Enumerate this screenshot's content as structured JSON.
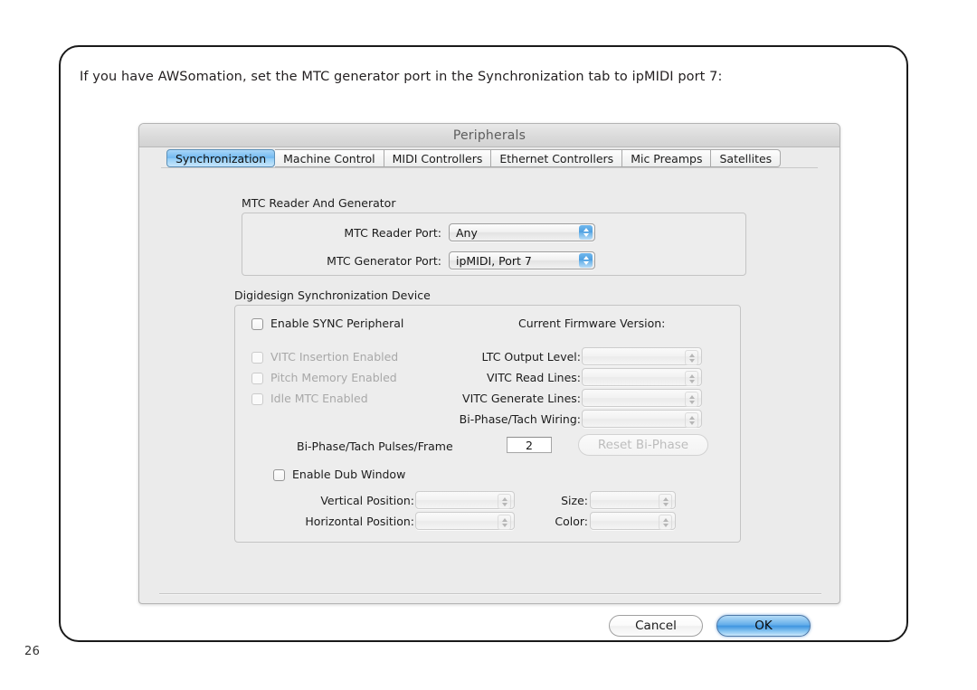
{
  "page": {
    "number": "26",
    "intro_text": "If you have AWSomation, set the MTC generator port in the Synchronization tab to ipMIDI port 7:"
  },
  "dialog": {
    "title": "Peripherals",
    "tabs": [
      {
        "label": "Synchronization",
        "active": true
      },
      {
        "label": "Machine Control",
        "active": false
      },
      {
        "label": "MIDI Controllers",
        "active": false
      },
      {
        "label": "Ethernet Controllers",
        "active": false
      },
      {
        "label": "Mic Preamps",
        "active": false
      },
      {
        "label": "Satellites",
        "active": false
      }
    ],
    "mtc_group": {
      "label": "MTC Reader And Generator",
      "reader_label": "MTC Reader Port:",
      "reader_value": "Any",
      "generator_label": "MTC Generator Port:",
      "generator_value": "ipMIDI, Port 7"
    },
    "sync_group": {
      "label": "Digidesign Synchronization Device",
      "enable_sync_label": "Enable SYNC Peripheral",
      "firmware_label": "Current Firmware Version:",
      "firmware_value": "",
      "vitc_insertion_label": "VITC Insertion Enabled",
      "pitch_memory_label": "Pitch Memory Enabled",
      "idle_mtc_label": "Idle MTC Enabled",
      "ltc_output_label": "LTC Output Level:",
      "ltc_output_value": "",
      "vitc_read_label": "VITC Read Lines:",
      "vitc_read_value": "",
      "vitc_generate_label": "VITC Generate Lines:",
      "vitc_generate_value": "",
      "biphase_wiring_label": "Bi-Phase/Tach Wiring:",
      "biphase_wiring_value": "",
      "biphase_pulses_label": "Bi-Phase/Tach Pulses/Frame",
      "biphase_pulses_value": "2",
      "reset_biphase_label": "Reset Bi-Phase",
      "enable_dub_label": "Enable Dub Window",
      "vertical_position_label": "Vertical Position:",
      "vertical_position_value": "",
      "horizontal_position_label": "Horizontal Position:",
      "horizontal_position_value": "",
      "size_label": "Size:",
      "size_value": "",
      "color_label": "Color:",
      "color_value": ""
    },
    "buttons": {
      "cancel_label": "Cancel",
      "ok_label": "OK"
    }
  },
  "colors": {
    "accent_blue": "#4f9fe0",
    "tab_active": "#72b9f0",
    "dialog_bg": "#ebebeb",
    "page_border": "#1a1a1a"
  }
}
